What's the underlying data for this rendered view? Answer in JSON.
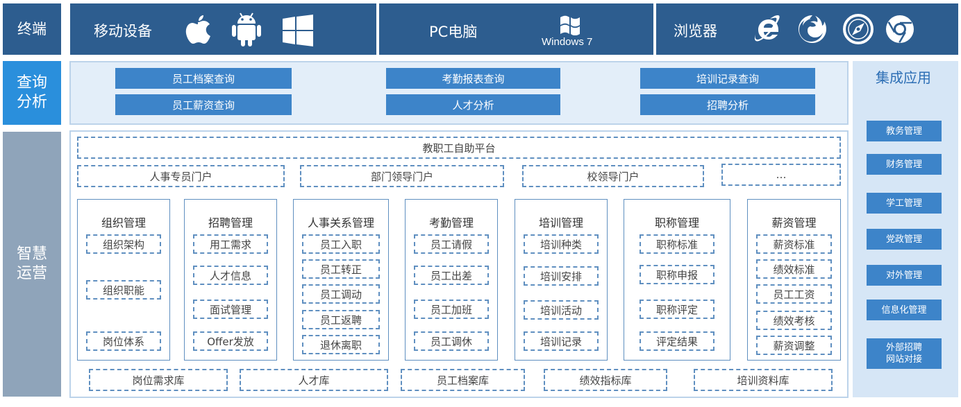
{
  "terminal": {
    "label": "终端",
    "mobile": {
      "label": "移动设备",
      "icons": [
        "apple-icon",
        "android-icon",
        "windows-icon"
      ]
    },
    "pc": {
      "label": "PC电脑",
      "os_logo_text": "Windows 7"
    },
    "browser": {
      "label": "浏览器",
      "icons": [
        "ie-icon",
        "firefox-icon",
        "safari-icon",
        "chrome-icon"
      ]
    }
  },
  "query": {
    "label_line1": "查询",
    "label_line2": "分析",
    "buttons": [
      "员工档案查询",
      "考勤报表查询",
      "培训记录查询",
      "员工薪资查询",
      "人才分析",
      "招聘分析"
    ]
  },
  "operations": {
    "label_line1": "智慧",
    "label_line2": "运营",
    "platform": "教职工自助平台",
    "portals": [
      "人事专员门户",
      "部门领导门户",
      "校领导门户",
      "…"
    ],
    "modules": [
      {
        "title": "组织管理",
        "items": [
          "组织架构",
          "组织职能",
          "岗位体系"
        ]
      },
      {
        "title": "招聘管理",
        "items": [
          "用工需求",
          "人才信息",
          "面试管理",
          "Offer发放"
        ]
      },
      {
        "title": "人事关系管理",
        "items": [
          "员工入职",
          "员工转正",
          "员工调动",
          "员工返聘",
          "退休离职"
        ]
      },
      {
        "title": "考勤管理",
        "items": [
          "员工请假",
          "员工出差",
          "员工加班",
          "员工调休"
        ]
      },
      {
        "title": "培训管理",
        "items": [
          "培训种类",
          "培训安排",
          "培训活动",
          "培训记录"
        ]
      },
      {
        "title": "职称管理",
        "items": [
          "职称标准",
          "职称申报",
          "职称评定",
          "评定结果"
        ]
      },
      {
        "title": "薪资管理",
        "items": [
          "薪资标准",
          "绩效标准",
          "员工工资",
          "绩效考核",
          "薪资调整"
        ]
      }
    ],
    "libraries": [
      "岗位需求库",
      "人才库",
      "员工档案库",
      "绩效指标库",
      "培训资料库"
    ]
  },
  "integration": {
    "title": "集成应用",
    "items": [
      "教务管理",
      "财务管理",
      "学工管理",
      "党政管理",
      "对外管理",
      "信息化管理",
      "外部招聘\n网站对接"
    ]
  }
}
